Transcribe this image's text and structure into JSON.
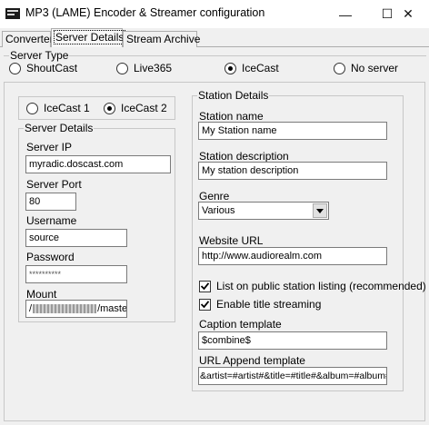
{
  "window": {
    "title": "MP3 (LAME) Encoder & Streamer configuration",
    "minimize_glyph": "—",
    "maximize_glyph": "☐",
    "close_glyph": "✕"
  },
  "tabs": [
    {
      "label": "Converter",
      "selected": false
    },
    {
      "label": "Server Details",
      "selected": true
    },
    {
      "label": "Stream Archive",
      "selected": false
    }
  ],
  "server_type": {
    "title": "Server Type",
    "options": [
      {
        "label": "ShoutCast",
        "selected": false
      },
      {
        "label": "Live365",
        "selected": false
      },
      {
        "label": "IceCast",
        "selected": true
      },
      {
        "label": "No server",
        "selected": false
      }
    ]
  },
  "icecast_version": {
    "options": [
      {
        "label": "IceCast 1",
        "selected": false
      },
      {
        "label": "IceCast 2",
        "selected": true
      }
    ]
  },
  "server_details": {
    "title": "Server Details",
    "server_ip_label": "Server IP",
    "server_ip": "myradic.doscast.com",
    "server_port_label": "Server Port",
    "server_port": "80",
    "username_label": "Username",
    "username": "source",
    "password_label": "Password",
    "password": "**********",
    "mount_label": "Mount",
    "mount_prefix": "/",
    "mount_suffix": "/master"
  },
  "station_details": {
    "title": "Station Details",
    "name_label": "Station name",
    "name": "My Station name",
    "description_label": "Station description",
    "description": "My station description",
    "genre_label": "Genre",
    "genre": "Various",
    "website_label": "Website URL",
    "website": "http://www.audiorealm.com",
    "public_listing_label": "List on public station listing (recommended)",
    "public_listing_checked": true,
    "title_streaming_label": "Enable title streaming",
    "title_streaming_checked": true,
    "caption_label": "Caption template",
    "caption": "$combine$",
    "url_append_label": "URL Append template",
    "url_append": "&artist=#artist#&title=#title#&album=#album#"
  }
}
